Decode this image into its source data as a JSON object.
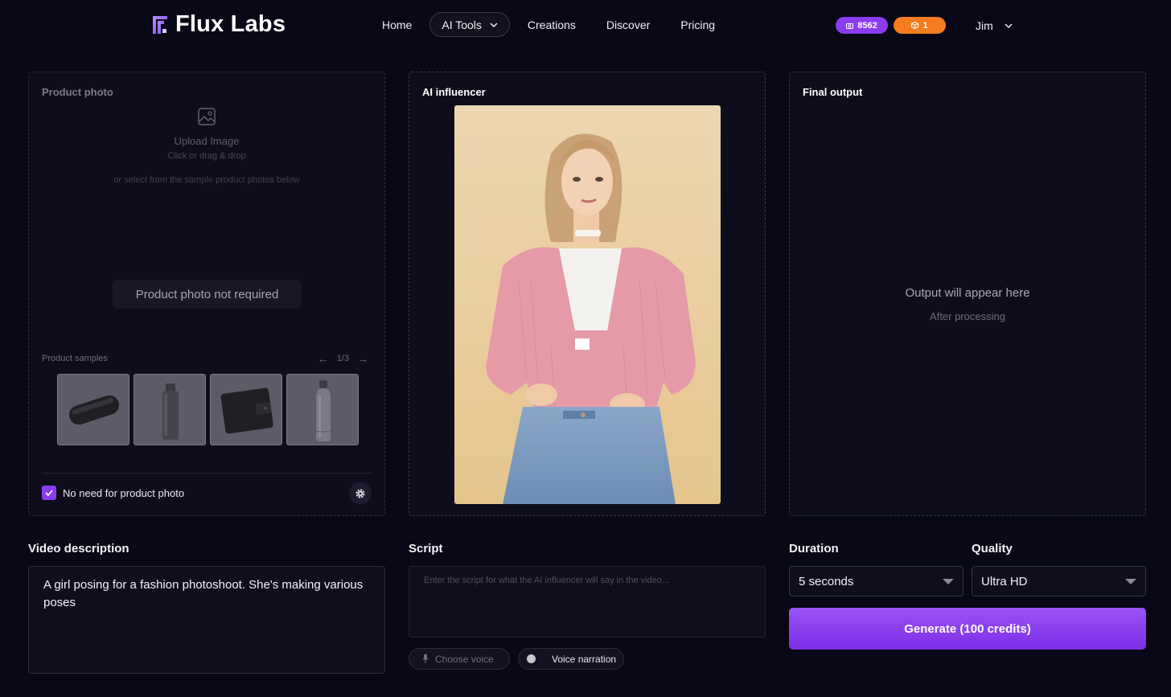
{
  "header": {
    "logo_text": "Flux Labs",
    "nav": {
      "home": "Home",
      "ai_tools": "AI Tools",
      "creations": "Creations",
      "discover": "Discover",
      "pricing": "Pricing"
    },
    "credits_badge": "8562",
    "orange_badge": "1",
    "user_name": "Jim"
  },
  "product_panel": {
    "title": "Product photo",
    "upload_title": "Upload Image",
    "upload_sub": "Click or drag & drop",
    "upload_hint": "or select from the sample product photos below",
    "not_required": "Product photo not required",
    "samples_label": "Product samples",
    "pager": "1/3",
    "samples": [
      "speaker",
      "bottle",
      "wallet",
      "water-bottle"
    ],
    "checkbox_label": "No need for product photo",
    "checkbox_checked": true
  },
  "influencer_panel": {
    "title": "AI influencer"
  },
  "output_panel": {
    "title": "Final output",
    "placeholder": "Output will appear here",
    "placeholder_sub": "After processing"
  },
  "form": {
    "video_description_label": "Video description",
    "video_description_value": "A girl posing for a fashion photoshoot. She's making various poses",
    "script_label": "Script",
    "script_placeholder": "Enter the script for what the AI influencer will say in the video...",
    "choose_voice": "Choose voice",
    "voice_narration": "Voice narration",
    "duration_label": "Duration",
    "duration_value": "5 seconds",
    "quality_label": "Quality",
    "quality_value": "Ultra HD",
    "generate_label": "Generate (100 credits)"
  },
  "colors": {
    "background": "#080816",
    "accent": "#8a3df0",
    "orange": "#f57c1f"
  }
}
